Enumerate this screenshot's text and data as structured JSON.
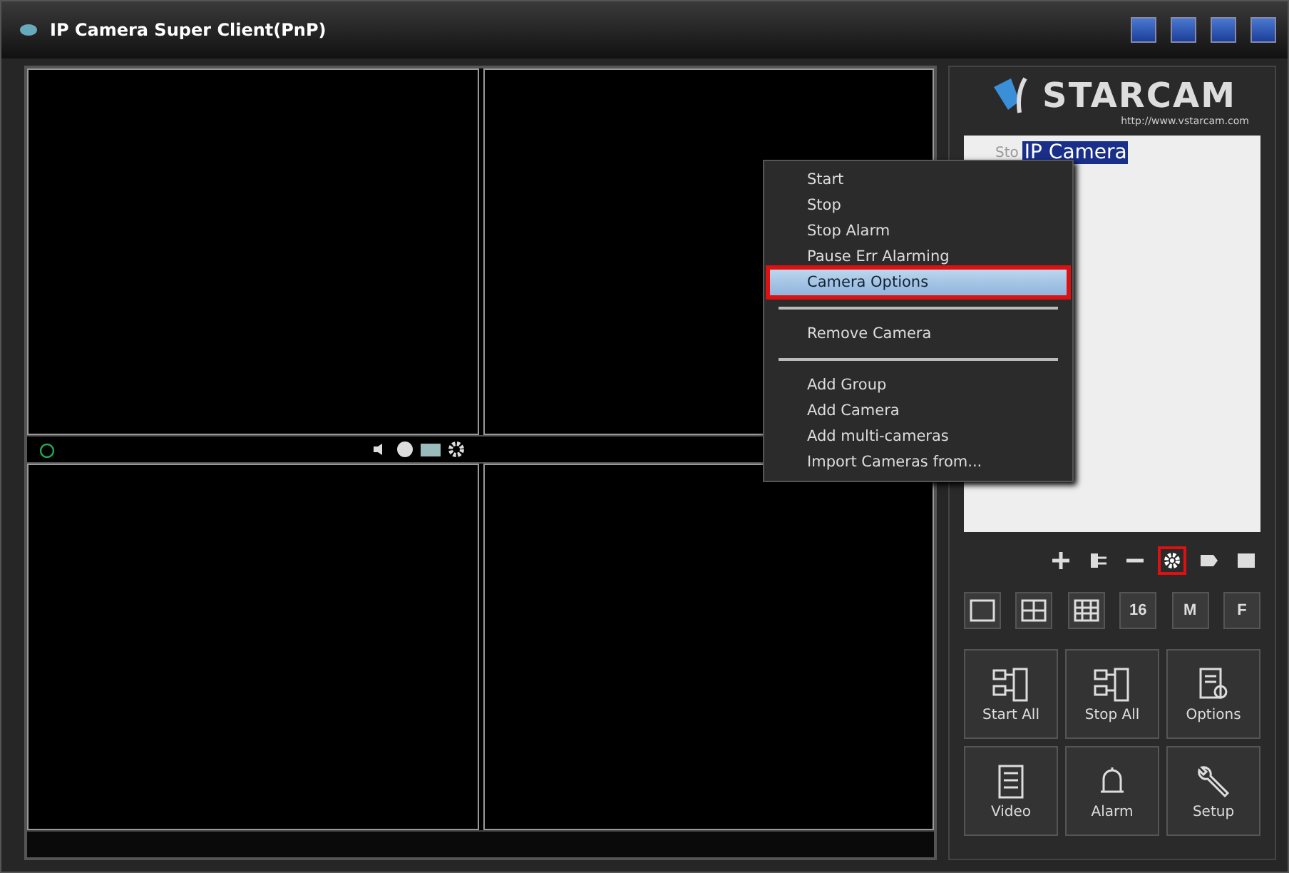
{
  "window": {
    "title": "IP Camera Super Client(PnP)"
  },
  "logo": {
    "brand": "STARCAM",
    "url": "http://www.vstarcam.com"
  },
  "camera_tree": [
    {
      "status": "Sto",
      "label": "IP Camera",
      "selected": true
    }
  ],
  "context_menu": [
    {
      "kind": "item",
      "label": "Start",
      "selected": false
    },
    {
      "kind": "item",
      "label": "Stop",
      "selected": false
    },
    {
      "kind": "item",
      "label": "Stop Alarm",
      "selected": false
    },
    {
      "kind": "item",
      "label": "Pause Err Alarming",
      "selected": false
    },
    {
      "kind": "item",
      "label": "Camera Options",
      "selected": true
    },
    {
      "kind": "separator"
    },
    {
      "kind": "item",
      "label": "Remove Camera",
      "selected": false
    },
    {
      "kind": "separator"
    },
    {
      "kind": "item",
      "label": "Add Group",
      "selected": false
    },
    {
      "kind": "item",
      "label": "Add Camera",
      "selected": false
    },
    {
      "kind": "item",
      "label": "Add multi-cameras",
      "selected": false
    },
    {
      "kind": "item",
      "label": "Import Cameras from...",
      "selected": false
    }
  ],
  "tree_tools": [
    {
      "kind": "add",
      "highlighted": false
    },
    {
      "kind": "plug",
      "highlighted": false
    },
    {
      "kind": "remove",
      "highlighted": false
    },
    {
      "kind": "settings",
      "highlighted": true
    },
    {
      "kind": "tag",
      "highlighted": false
    },
    {
      "kind": "card",
      "highlighted": false
    }
  ],
  "layouts": [
    {
      "kind": "single"
    },
    {
      "kind": "quad"
    },
    {
      "kind": "nine"
    },
    {
      "kind": "text",
      "label": "16"
    },
    {
      "kind": "text",
      "label": "M"
    },
    {
      "kind": "text",
      "label": "F"
    }
  ],
  "actions": [
    {
      "kind": "start",
      "label": "Start All"
    },
    {
      "kind": "stop",
      "label": "Stop All"
    },
    {
      "kind": "options",
      "label": "Options"
    },
    {
      "kind": "video",
      "label": "Video"
    },
    {
      "kind": "alarm",
      "label": "Alarm"
    },
    {
      "kind": "setup",
      "label": "Setup"
    }
  ]
}
